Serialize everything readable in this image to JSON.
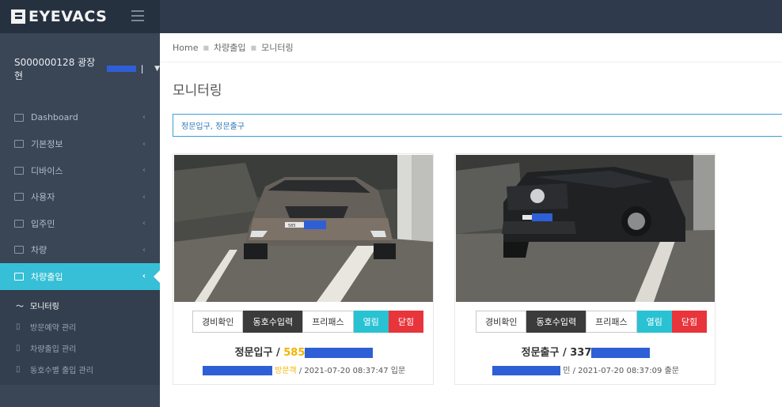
{
  "app": {
    "name": "EYEVACS"
  },
  "user": {
    "account": "S000000128 광장 현",
    "account_suffix": "ㅣ"
  },
  "sidebar": {
    "items": [
      {
        "label": "Dashboard"
      },
      {
        "label": "기본정보"
      },
      {
        "label": "디바이스"
      },
      {
        "label": "사용자"
      },
      {
        "label": "입주민"
      },
      {
        "label": "차량"
      },
      {
        "label": "차량출입"
      }
    ],
    "submenu": [
      {
        "label": "모니터링"
      },
      {
        "label": "방문예약 관리"
      },
      {
        "label": "차량출입 관리"
      },
      {
        "label": "동호수별 출입 관리"
      }
    ]
  },
  "breadcrumb": {
    "home": "Home",
    "level1": "차량출입",
    "level2": "모니터링"
  },
  "page": {
    "title": "모니터링",
    "filter": "정문입구, 정문출구"
  },
  "cards": [
    {
      "gate": "정문입구 / ",
      "plate_visible": "585",
      "buttons": [
        "경비확인",
        "동호수입력",
        "프리패스",
        "열림",
        "닫힘"
      ],
      "visitor_label": "방문객",
      "timestamp": "/ 2021-07-20 08:37:47 입문",
      "plate_label": "585"
    },
    {
      "gate": "정문출구 / ",
      "plate_visible": "337",
      "buttons": [
        "경비확인",
        "동호수입력",
        "프리패스",
        "열림",
        "닫힘"
      ],
      "visitor_label": "민",
      "timestamp": "/ 2021-07-20 08:37:09 출문"
    }
  ],
  "colors": {
    "topbar": "#2f3a4c",
    "sidebar": "#3a4556",
    "accent": "#36bfd6",
    "open": "#29c2d3",
    "close": "#e8343b",
    "redaction": "#2f5fd6"
  }
}
